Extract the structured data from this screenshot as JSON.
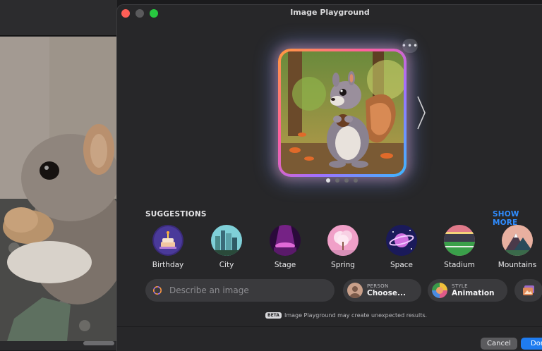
{
  "window": {
    "title": "Image Playground"
  },
  "colors": {
    "accent": "#2f8cff",
    "close": "#ff5f57",
    "minimize": "#5a5a5c",
    "zoom": "#28c840"
  },
  "preview": {
    "page_count": 4,
    "active_page": 1
  },
  "suggestions": {
    "heading": "SUGGESTIONS",
    "show_more": "SHOW MORE",
    "items": [
      {
        "label": "Birthday",
        "icon": "birthday-cake-icon"
      },
      {
        "label": "City",
        "icon": "city-skyline-icon"
      },
      {
        "label": "Stage",
        "icon": "stage-spotlight-icon"
      },
      {
        "label": "Spring",
        "icon": "blossom-tree-icon"
      },
      {
        "label": "Space",
        "icon": "planet-icon"
      },
      {
        "label": "Stadium",
        "icon": "stadium-icon"
      },
      {
        "label": "Mountains",
        "icon": "mountain-icon"
      }
    ]
  },
  "prompt": {
    "placeholder": "Describe an image"
  },
  "person": {
    "caption": "PERSON",
    "value": "Choose..."
  },
  "style": {
    "caption": "STYLE",
    "value": "Animation"
  },
  "notice": {
    "badge": "BETA",
    "text": "Image Playground may create unexpected results."
  },
  "footer": {
    "cancel": "Cancel",
    "done": "Done"
  }
}
